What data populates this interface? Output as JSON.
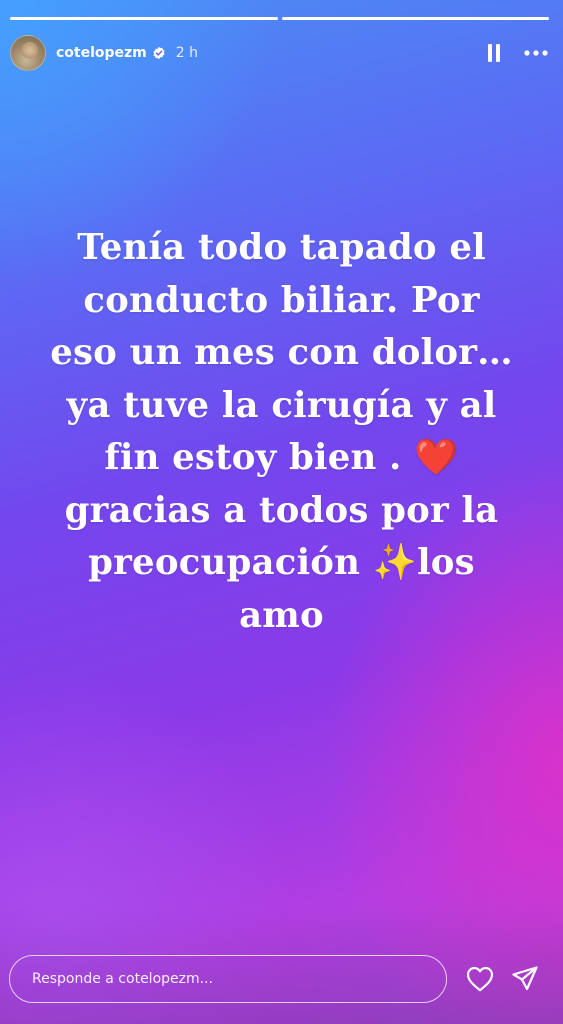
{
  "progress": {
    "segments": [
      {
        "fill": 1.0
      },
      {
        "fill": 1.0
      }
    ]
  },
  "header": {
    "username": "cotelopezm",
    "verified": true,
    "time": "2 h"
  },
  "story": {
    "lines": [
      {
        "text": "Tenía todo tapado el"
      },
      {
        "text": "conducto biliar. Por"
      },
      {
        "text": "eso un mes con dolor…"
      },
      {
        "text": "ya tuve la cirugía y al"
      },
      {
        "text": "fin estoy bien . ",
        "emoji": "❤️",
        "emoji_name": "heart-emoji"
      },
      {
        "text": "gracias a todos por la"
      },
      {
        "text": "preocupación ",
        "emoji": "✨",
        "emoji_name": "sparkles-emoji",
        "after": "los"
      },
      {
        "text": "amo"
      }
    ]
  },
  "footer": {
    "reply_placeholder": "Responde a cotelopezm..."
  },
  "icons": {
    "verified": "verified-badge-icon",
    "pause": "pause-icon",
    "more": "more-options-icon",
    "like": "heart-outline-icon",
    "share": "send-icon"
  },
  "colors": {
    "gradient_top": "#4a8ff5",
    "gradient_mid": "#7446ee",
    "gradient_bottom": "#b23ee2",
    "heart_emoji": "#ef2740",
    "sparkles_emoji": "#ffd23c"
  }
}
